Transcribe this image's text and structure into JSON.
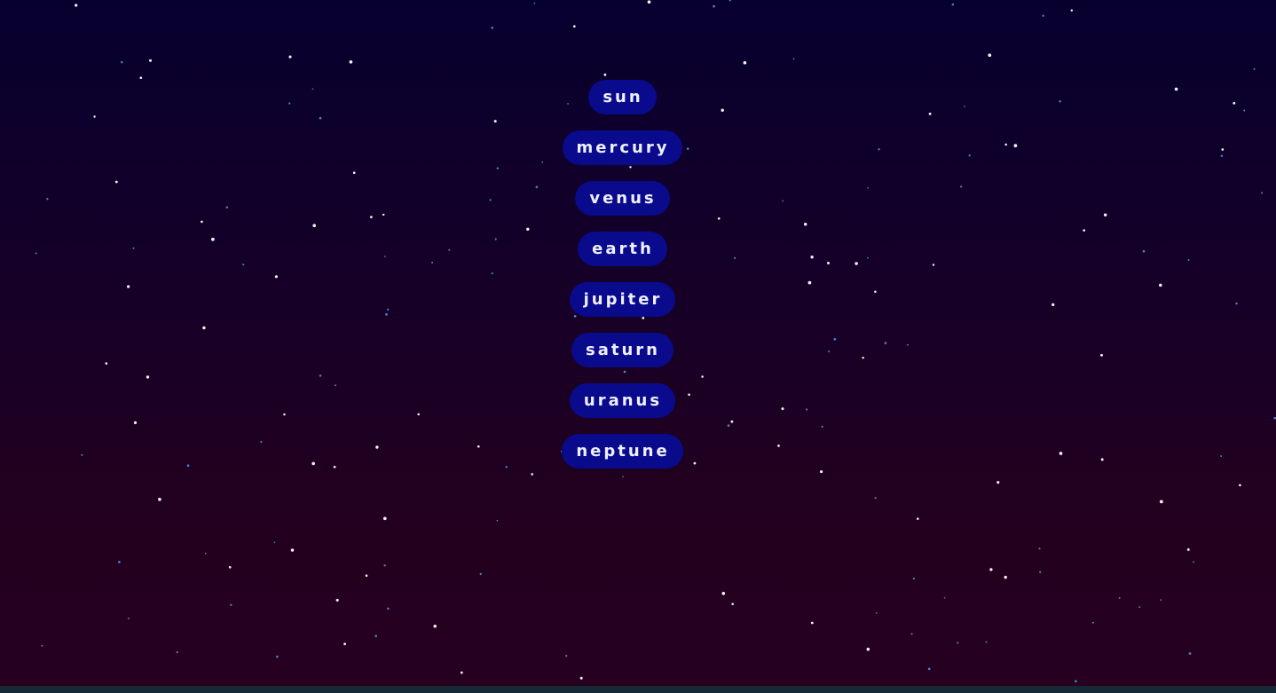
{
  "planets": {
    "items": [
      {
        "label": "sun"
      },
      {
        "label": "mercury"
      },
      {
        "label": "venus"
      },
      {
        "label": "earth"
      },
      {
        "label": "jupiter"
      },
      {
        "label": "saturn"
      },
      {
        "label": "uranus"
      },
      {
        "label": "neptune"
      }
    ]
  },
  "colors": {
    "background_top": "#07002e",
    "background_bottom": "#270020",
    "button_background": "#0a0a8c",
    "button_text": "#eef0ff",
    "star_white": "#ffffff",
    "star_blue": "#5f8fe6"
  }
}
